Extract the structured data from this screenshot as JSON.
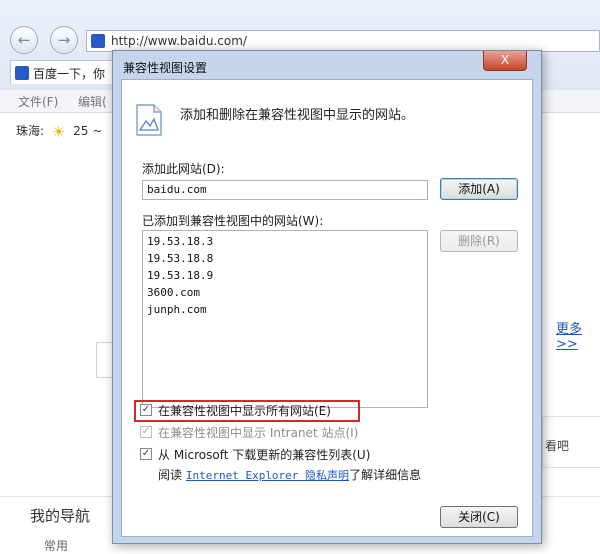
{
  "browser": {
    "address": "http://www.baidu.com/",
    "tab_title": "百度一下，你",
    "menu": [
      "文件(F)",
      "编辑("
    ],
    "weather": {
      "city": "珠海:",
      "temp": "25 ~"
    },
    "more_link": "更多>>",
    "right_fragment": "看吧",
    "my_nav": {
      "title": "我的导航",
      "sub": "常用"
    }
  },
  "dialog": {
    "title": "兼容性视图设置",
    "close_label": "X",
    "header_text": "添加和删除在兼容性视图中显示的网站。",
    "add_site_label": "添加此网站(D):",
    "add_site_value": "baidu.com",
    "add_button": "添加(A)",
    "list_label": "已添加到兼容性视图中的网站(W):",
    "sites": [
      "19.53.18.3",
      "19.53.18.8",
      "19.53.18.9",
      "3600.com",
      "junph.com"
    ],
    "remove_button": "删除(R)",
    "options": [
      {
        "label": "在兼容性视图中显示所有网站(E)",
        "checked": true,
        "enabled": true
      },
      {
        "label": "在兼容性视图中显示 Intranet 站点(I)",
        "checked": true,
        "enabled": false
      },
      {
        "label": "从 Microsoft 下载更新的兼容性列表(U)",
        "checked": true,
        "enabled": true
      }
    ],
    "privacy_prefix": "阅读",
    "privacy_link": "Internet Explorer 隐私声明",
    "privacy_suffix": "了解详细信息",
    "close_button": "关闭(C)",
    "highlight_color": "#d22a2a"
  }
}
